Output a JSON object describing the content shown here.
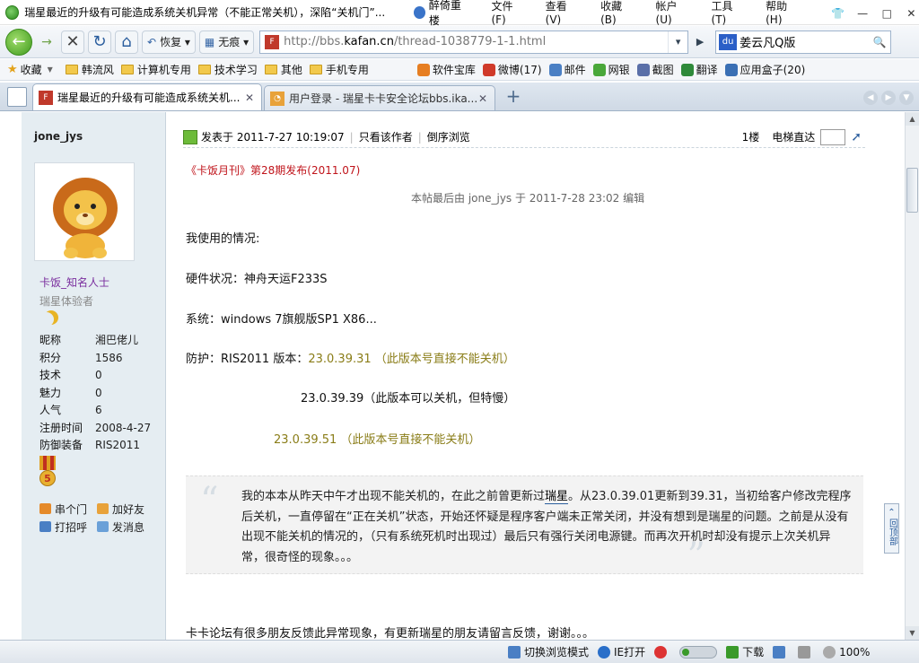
{
  "window": {
    "title": "瑞星最近的升级有可能造成系统关机异常（不能正常关机），深陷“关机门”...",
    "user": "醉倚重楼",
    "menu": [
      "文件(F)",
      "查看(V)",
      "收藏(B)",
      "帐户(U)",
      "工具(T)",
      "帮助(H)"
    ],
    "controls": {
      "shirt": "👕",
      "min": "—",
      "max": "□",
      "close": "✕"
    }
  },
  "nav": {
    "back": "←",
    "forward": "→",
    "stop": "✕",
    "refresh": "↻",
    "home": "⌂",
    "restore_label": "恢复",
    "ad_label": "无痕",
    "url_prefix": "http://bbs.",
    "url_domain": "kafan.cn",
    "url_suffix": "/thread-1038779-1-1.html",
    "search_value": "姜云凡Q版",
    "search_engine": "du"
  },
  "bookmarks": [
    {
      "label": "收藏",
      "kind": "star"
    },
    {
      "label": "韩流风",
      "kind": "folder"
    },
    {
      "label": "计算机专用",
      "kind": "folder"
    },
    {
      "label": "技术学习",
      "kind": "folder"
    },
    {
      "label": "其他",
      "kind": "folder"
    },
    {
      "label": "手机专用",
      "kind": "folder"
    }
  ],
  "toolbar_right": [
    {
      "label": "软件宝库",
      "color": "#e67e22"
    },
    {
      "label": "微博(17)",
      "color": "#d03a2a"
    },
    {
      "label": "邮件",
      "color": "#4a7fc4"
    },
    {
      "label": "网银",
      "color": "#4aa83a"
    },
    {
      "label": "截图",
      "color": "#5a6fa8"
    },
    {
      "label": "翻译",
      "color": "#2f8a3a"
    },
    {
      "label": "应用盒子(20)",
      "color": "#3a6fb4"
    }
  ],
  "tabs": [
    {
      "label": "瑞星最近的升级有可能造成系统关机...",
      "active": true
    },
    {
      "label": "用户登录 - 瑞星卡卡安全论坛bbs.ika...",
      "active": false
    }
  ],
  "profile": {
    "username": "jone_jys",
    "rank": "卡饭_知名人士",
    "group": "瑞星体验者",
    "stats": [
      {
        "k": "昵称",
        "v": "湘巴佬儿"
      },
      {
        "k": "积分",
        "v": "1586"
      },
      {
        "k": "技术",
        "v": "0"
      },
      {
        "k": "魅力",
        "v": "0"
      },
      {
        "k": "人气",
        "v": "6"
      },
      {
        "k": "注册时间",
        "v": "2008-4-27"
      },
      {
        "k": "防御装备",
        "v": "RIS2011"
      }
    ],
    "medal_level": "5",
    "links": [
      "串个门",
      "加好友",
      "打招呼",
      "发消息"
    ]
  },
  "post": {
    "posted": "发表于 2011-7-27 10:19:07",
    "only_author": "只看该作者",
    "reverse": "倒序浏览",
    "floor": "1楼",
    "elevator": "电梯直达",
    "monthly": "《卡饭月刊》第28期发布(2011.07)",
    "edited": "本帖最后由 jone_jys 于 2011-7-28 23:02 编辑",
    "situation": "我使用的情况:",
    "hardware": "硬件状况：神舟天运F233S",
    "system": "系统：windows 7旗舰版SP1  X86...",
    "protect_prefix": "防护：RIS2011  版本：",
    "v1": "23.0.39.31 （此版本号直接不能关机）",
    "v2": "23.0.39.39（此版本可以关机，但特慢）",
    "v3": "23.0.39.51 （此版本号直接不能关机）",
    "quote_before": "我的本本从昨天中午才出现不能关机的，在此之前曾更新过",
    "quote_link": "瑞星",
    "quote_after": "。从23.0.39.01更新到39.31，当初给客户修改完程序后关机，一直停留在“正在关机”状态，开始还怀疑是程序客户端未正常关闭，并没有想到是瑞星的问题。之前是从没有出现不能关机的情况的，（只有系统死机时出现过）最后只有强行关闭电源键。而再次开机时却没有提示上次关机异常，很奇怪的现象。。。",
    "bottom": "卡卡论坛有很多朋友反馈此异常现象，有更新瑞星的朋友请留言反馈，谢谢。。。",
    "back_top": "回顶部"
  },
  "status": {
    "mode": "切换浏览模式",
    "ie": "IE打开",
    "download": "下载",
    "zoom": "100%"
  }
}
